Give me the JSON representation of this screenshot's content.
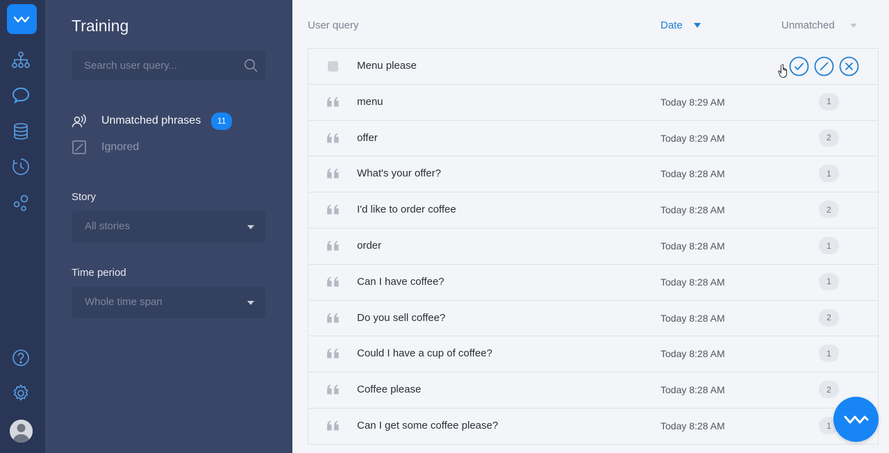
{
  "rail": {
    "icons": [
      "logo-icon",
      "structure-icon",
      "chat-icon",
      "database-icon",
      "history-icon",
      "integrations-icon",
      "help-icon",
      "settings-icon",
      "avatar"
    ]
  },
  "sidebar": {
    "title": "Training",
    "search_placeholder": "Search user query...",
    "nav": [
      {
        "label": "Unmatched phrases",
        "badge": "11"
      },
      {
        "label": "Ignored"
      }
    ],
    "story_label": "Story",
    "story_value": "All stories",
    "time_label": "Time period",
    "time_value": "Whole time span"
  },
  "main": {
    "header": {
      "query_label": "User query",
      "date_label": "Date",
      "filter_label": "Unmatched"
    },
    "first_row": {
      "text": "Menu please"
    },
    "rows": [
      {
        "text": "menu",
        "time": "Today 8:29 AM",
        "count": "1"
      },
      {
        "text": "offer",
        "time": "Today 8:29 AM",
        "count": "2"
      },
      {
        "text": "What's your offer?",
        "time": "Today 8:28 AM",
        "count": "1"
      },
      {
        "text": "I'd like to order coffee",
        "time": "Today 8:28 AM",
        "count": "2"
      },
      {
        "text": "order",
        "time": "Today 8:28 AM",
        "count": "1"
      },
      {
        "text": "Can I have coffee?",
        "time": "Today 8:28 AM",
        "count": "1"
      },
      {
        "text": "Do you sell coffee?",
        "time": "Today 8:28 AM",
        "count": "2"
      },
      {
        "text": "Could I have a cup of coffee?",
        "time": "Today 8:28 AM",
        "count": "1"
      },
      {
        "text": "Coffee please",
        "time": "Today 8:28 AM",
        "count": "2"
      },
      {
        "text": "Can I get some coffee please?",
        "time": "Today 8:28 AM",
        "count": "1"
      }
    ]
  },
  "colors": {
    "accent": "#1785f5",
    "rail_bg": "#2a3656",
    "panel_bg": "#3a4667",
    "main_bg": "#f3f5f8"
  }
}
